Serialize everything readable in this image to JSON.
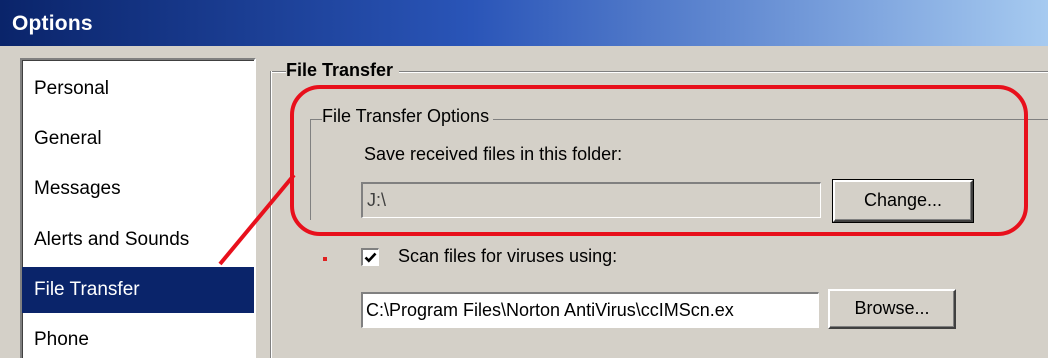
{
  "window": {
    "title": "Options"
  },
  "categories": [
    {
      "label": "Personal",
      "selected": false
    },
    {
      "label": "General",
      "selected": false
    },
    {
      "label": "Messages",
      "selected": false
    },
    {
      "label": "Alerts and Sounds",
      "selected": false
    },
    {
      "label": "File Transfer",
      "selected": true
    },
    {
      "label": "Phone",
      "selected": false
    }
  ],
  "panel": {
    "section_title": "File Transfer",
    "group_title": "File Transfer Options",
    "save_label": "Save received files in this folder:",
    "folder_value": "J:\\",
    "change_label": "Change...",
    "scan_checked": true,
    "scan_label": "Scan files for viruses using:",
    "scan_value": "C:\\Program Files\\Norton AntiVirus\\ccIMScn.ex",
    "browse_label": "Browse..."
  },
  "annotation": {
    "color": "#e8101c",
    "shape": "rounded-rectangle-callout"
  },
  "colors": {
    "selection": "#0a246a",
    "dialog_face": "#d4d0c8"
  }
}
